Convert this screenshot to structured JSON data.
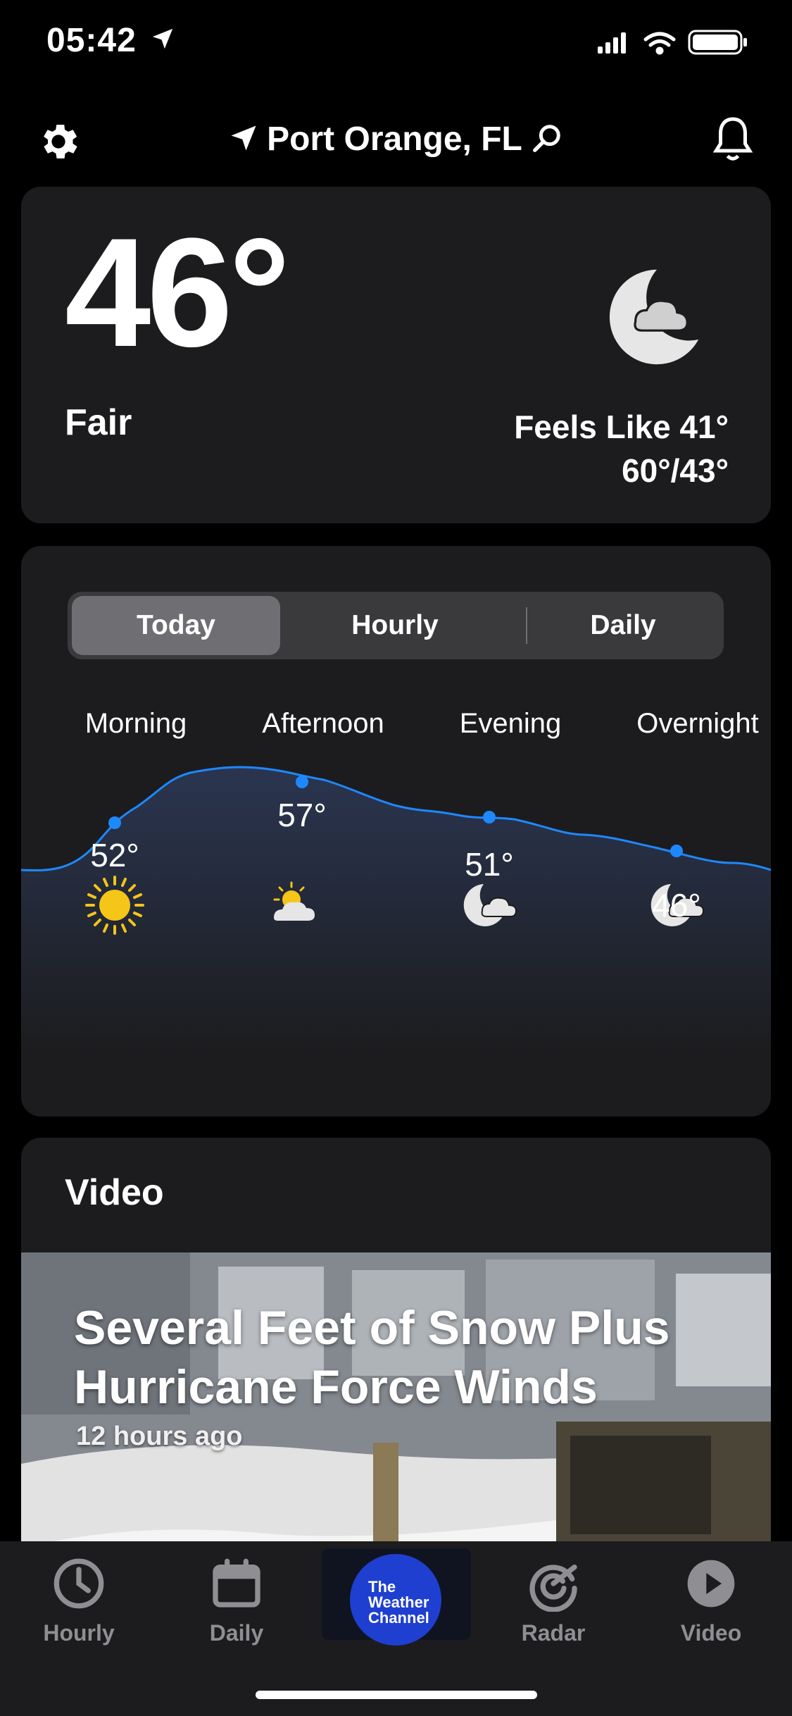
{
  "status_bar": {
    "time": "05:42"
  },
  "header": {
    "location": "Port Orange, FL"
  },
  "current": {
    "temperature": "46°",
    "condition": "Fair",
    "feels_like": "Feels Like 41°",
    "high_low": "60°/43°"
  },
  "forecast": {
    "tabs": [
      "Today",
      "Hourly",
      "Daily"
    ],
    "selected_tab": "Today",
    "periods": [
      {
        "name": "Morning",
        "temp": "52°",
        "icon": "sun-icon"
      },
      {
        "name": "Afternoon",
        "temp": "57°",
        "icon": "partly-sunny-icon"
      },
      {
        "name": "Evening",
        "temp": "51°",
        "icon": "cloudy-night-icon"
      },
      {
        "name": "Overnight",
        "temp": "46°",
        "icon": "cloudy-night-icon"
      }
    ],
    "line_color": "#1e88ff"
  },
  "video": {
    "section_title": "Video",
    "headline": "Several Feet of Snow Plus Hurricane Force Winds",
    "time_ago": "12 hours ago"
  },
  "tabbar": {
    "items": [
      {
        "label": "Hourly",
        "icon": "clock-icon"
      },
      {
        "label": "Daily",
        "icon": "calendar-icon"
      },
      {
        "label": "The Weather Channel",
        "icon": "weather-channel-logo"
      },
      {
        "label": "Radar",
        "icon": "radar-icon"
      },
      {
        "label": "Video",
        "icon": "play-icon"
      }
    ]
  },
  "logo": {
    "lines": [
      "The",
      "Weather",
      "Channel"
    ]
  },
  "colors": {
    "background": "#000000",
    "card": "#1c1c1e",
    "accent": "#1f3fd0"
  }
}
